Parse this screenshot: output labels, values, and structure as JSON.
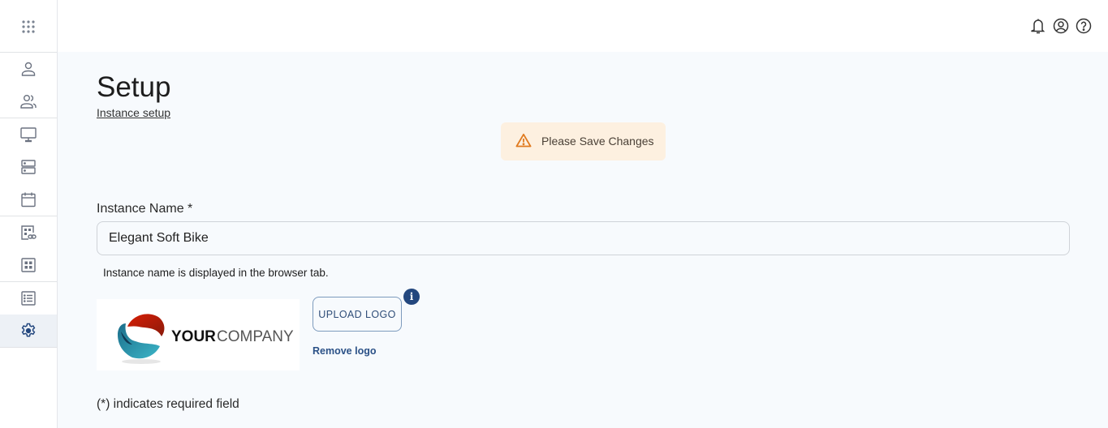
{
  "sidebar": {
    "items": [
      {
        "name": "apps-grid",
        "label": "Apps"
      },
      {
        "name": "user",
        "label": "User"
      },
      {
        "name": "users-group",
        "label": "Users"
      },
      {
        "name": "monitor",
        "label": "Desktops"
      },
      {
        "name": "server",
        "label": "Servers"
      },
      {
        "name": "calendar",
        "label": "Calendar"
      },
      {
        "name": "linked-grid",
        "label": "Links"
      },
      {
        "name": "grid",
        "label": "Apps"
      },
      {
        "name": "list",
        "label": "List"
      },
      {
        "name": "settings",
        "label": "Settings",
        "active": true
      }
    ]
  },
  "topbar": {
    "icons": [
      "bell-icon",
      "account-icon",
      "help-icon"
    ]
  },
  "page": {
    "title": "Setup",
    "breadcrumb": "Instance setup"
  },
  "alert": {
    "icon": "warning-icon",
    "text": "Please Save Changes",
    "color": "#e07a1f",
    "background": "#fdf0e0"
  },
  "form": {
    "instance_name_label": "Instance Name *",
    "instance_name_value": "Elegant Soft Bike",
    "instance_name_help": "Instance name is displayed in the browser tab.",
    "logo": {
      "text_bold": "YOUR",
      "text_light": "COMPANY"
    },
    "upload_logo_label": "UPLOAD LOGO",
    "info_label": "i",
    "remove_logo_label": "Remove logo",
    "required_note": "(*) indicates required field"
  },
  "colors": {
    "accent": "#23477e",
    "active_sidebar_bg": "#edf1f6",
    "icon_gray": "#6b7280"
  }
}
